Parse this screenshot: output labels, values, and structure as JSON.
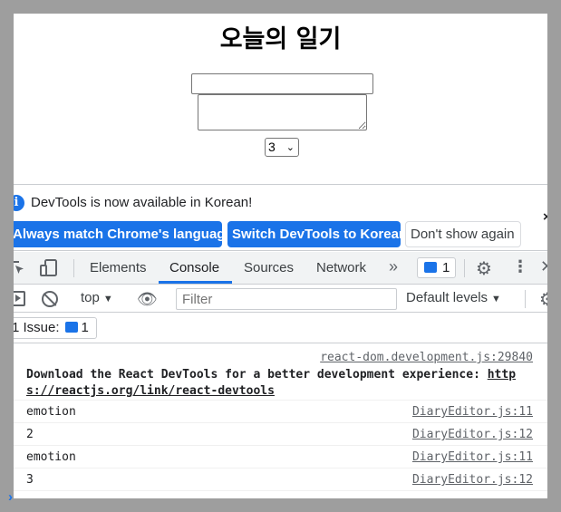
{
  "app": {
    "title": "오늘의 일기",
    "emotion_value": "3"
  },
  "infobar": {
    "message": "DevTools is now available in Korean!",
    "match_label": "Always match Chrome's language",
    "switch_label": "Switch DevTools to Korean",
    "dont_show_label": "Don't show again",
    "close_glyph": "×"
  },
  "tabs": [
    {
      "label": "Elements"
    },
    {
      "label": "Console",
      "active": true
    },
    {
      "label": "Sources"
    },
    {
      "label": "Network"
    }
  ],
  "toolbar": {
    "more_glyph": "»",
    "issues_count": "1",
    "settings_glyph": "⚙",
    "kebab_glyph": "⋮",
    "close_glyph": "✕"
  },
  "console_toolbar": {
    "context": "top",
    "chevron": "▼",
    "eye_glyph": "👁",
    "filter_placeholder": "Filter",
    "levels": "Default levels",
    "settings_glyph": "⚙"
  },
  "issues": {
    "label": "1 Issue:",
    "count": "1"
  },
  "console": {
    "rows": [
      {
        "source": "react-dom.development.js:29840",
        "message": "Download the React DevTools for a better development experience: ",
        "link": "https://reactjs.org/link/react-devtools"
      },
      {
        "message": "emotion",
        "source": "DiaryEditor.js:11"
      },
      {
        "message": "2",
        "source": "DiaryEditor.js:12"
      },
      {
        "message": "emotion",
        "source": "DiaryEditor.js:11"
      },
      {
        "message": "3",
        "source": "DiaryEditor.js:12"
      }
    ],
    "prompt_glyph": "›"
  },
  "colors": {
    "accent": "#1a73e8",
    "backdrop": "#9e9e9e",
    "toolbar_bg": "#f1f3f4"
  }
}
